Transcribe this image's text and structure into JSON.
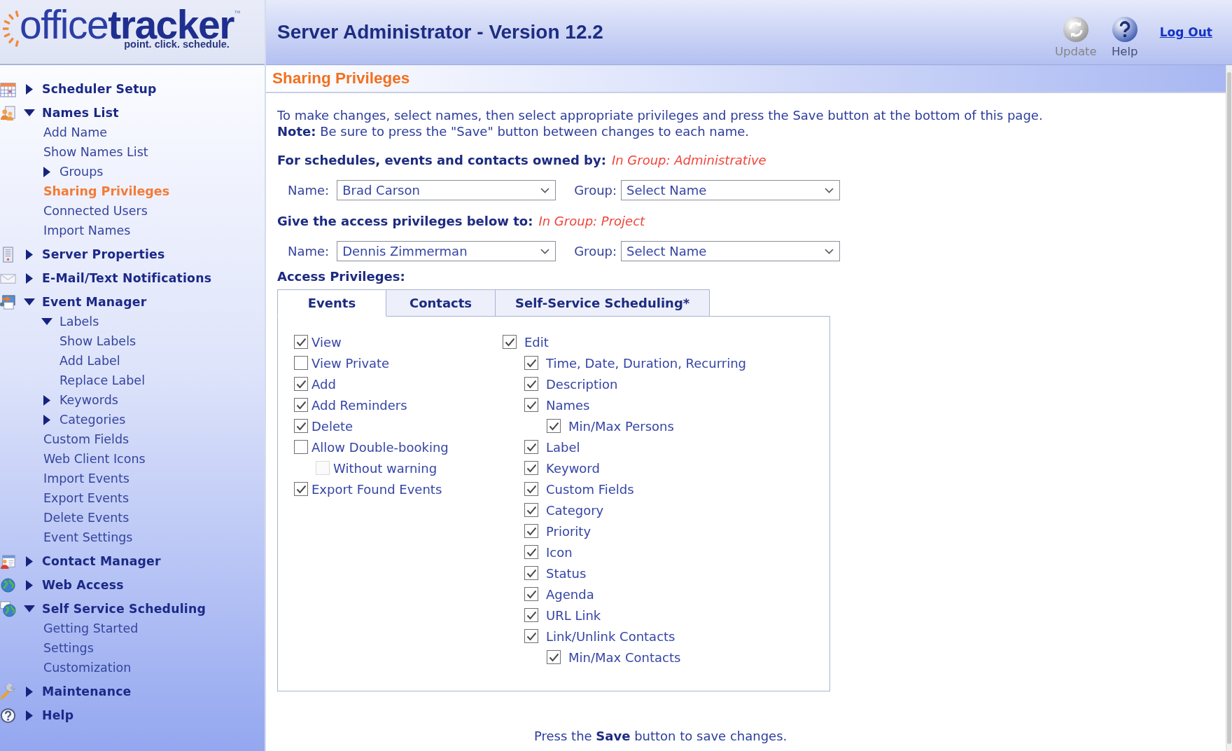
{
  "logo": {
    "brand_light": "office",
    "brand_bold": "tracker",
    "trademark": "™",
    "tagline": "point. click. schedule."
  },
  "sidebar": {
    "items": [
      {
        "label": "Scheduler Setup",
        "expanded": false,
        "selected": false
      },
      {
        "label": "Names List",
        "expanded": true,
        "selected": false,
        "children": [
          {
            "label": "Add Name",
            "selected": false
          },
          {
            "label": "Show Names List",
            "selected": false
          },
          {
            "label": "Groups",
            "expanded": false,
            "selected": false
          },
          {
            "label": "Sharing Privileges",
            "selected": true
          },
          {
            "label": "Connected Users",
            "selected": false
          },
          {
            "label": "Import Names",
            "selected": false
          }
        ]
      },
      {
        "label": "Server Properties",
        "expanded": false,
        "selected": false
      },
      {
        "label": "E-Mail/Text Notifications",
        "expanded": false,
        "selected": false
      },
      {
        "label": "Event Manager",
        "expanded": true,
        "selected": false,
        "children": [
          {
            "label": "Labels",
            "expanded": true,
            "selected": false,
            "children": [
              {
                "label": "Show Labels",
                "selected": false
              },
              {
                "label": "Add Label",
                "selected": false
              },
              {
                "label": "Replace Label",
                "selected": false
              }
            ]
          },
          {
            "label": "Keywords",
            "expanded": false,
            "selected": false
          },
          {
            "label": "Categories",
            "expanded": false,
            "selected": false
          },
          {
            "label": "Custom Fields",
            "selected": false
          },
          {
            "label": "Web Client Icons",
            "selected": false
          },
          {
            "label": "Import Events",
            "selected": false
          },
          {
            "label": "Export Events",
            "selected": false
          },
          {
            "label": "Delete Events",
            "selected": false
          },
          {
            "label": "Event Settings",
            "selected": false
          }
        ]
      },
      {
        "label": "Contact Manager",
        "expanded": false,
        "selected": false
      },
      {
        "label": "Web Access",
        "expanded": false,
        "selected": false
      },
      {
        "label": "Self Service Scheduling",
        "expanded": true,
        "selected": false,
        "children": [
          {
            "label": "Getting Started",
            "selected": false
          },
          {
            "label": "Settings",
            "selected": false
          },
          {
            "label": "Customization",
            "selected": false
          }
        ]
      },
      {
        "label": "Maintenance",
        "expanded": false,
        "selected": false
      },
      {
        "label": "Help",
        "expanded": false,
        "selected": false
      }
    ]
  },
  "header": {
    "title": "Server Administrator - Version 12.2",
    "buttons": [
      {
        "label": "Update",
        "disabled": true
      },
      {
        "label": "Help",
        "disabled": false
      }
    ],
    "logout": "Log Out"
  },
  "page": {
    "heading": "Sharing Privileges",
    "intro": "To make changes, select names, then select appropriate privileges and press the Save button at the bottom of this page.",
    "note": "**Note:** Be sure to press the \"Save\" button between changes to each name.",
    "owner": {
      "heading": "For schedules, events and contacts owned by:",
      "group_info": "In Group: Administrative",
      "fields": [
        {
          "label": "Name:",
          "value": "Brad Carson"
        },
        {
          "label": "Group:",
          "value": "Select Name"
        }
      ]
    },
    "recipient": {
      "heading": "Give the access privileges below to:",
      "group_info": "In Group: Project",
      "fields": [
        {
          "label": "Name:",
          "value": "Dennis Zimmerman"
        },
        {
          "label": "Group:",
          "value": "Select Name"
        }
      ]
    },
    "access_label": "Access Privileges:",
    "tabs": [
      {
        "label": "Events",
        "selected": true
      },
      {
        "label": "Contacts",
        "selected": false
      },
      {
        "label": "Self-Service Scheduling*",
        "selected": false
      }
    ],
    "columns": [
      {
        "items": [
          {
            "label": "View",
            "checked": true,
            "disabled": false
          },
          {
            "label": "View Private",
            "checked": false,
            "disabled": false
          },
          {
            "label": "Add",
            "checked": true,
            "disabled": false
          },
          {
            "label": "Add Reminders",
            "checked": true,
            "disabled": false
          },
          {
            "label": "Delete",
            "checked": true,
            "disabled": false
          },
          {
            "label": "Allow Double-booking",
            "checked": false,
            "disabled": false,
            "children": [
              {
                "label": "Without warning",
                "checked": false,
                "disabled": true
              }
            ]
          },
          {
            "label": "Export Found Events",
            "checked": true,
            "disabled": false
          }
        ]
      },
      {
        "items": [
          {
            "label": "Edit",
            "checked": true,
            "disabled": false,
            "children": [
              {
                "label": "Time, Date, Duration, Recurring",
                "checked": true,
                "disabled": false
              },
              {
                "label": "Description",
                "checked": true,
                "disabled": false
              },
              {
                "label": "Names",
                "checked": true,
                "disabled": false,
                "children": [
                  {
                    "label": "Min/Max Persons",
                    "checked": true,
                    "disabled": false
                  }
                ]
              },
              {
                "label": "Label",
                "checked": true,
                "disabled": false
              },
              {
                "label": "Keyword",
                "checked": true,
                "disabled": false
              },
              {
                "label": "Custom Fields",
                "checked": true,
                "disabled": false
              },
              {
                "label": "Category",
                "checked": true,
                "disabled": false
              },
              {
                "label": "Priority",
                "checked": true,
                "disabled": false
              },
              {
                "label": "Icon",
                "checked": true,
                "disabled": false
              },
              {
                "label": "Status",
                "checked": true,
                "disabled": false
              },
              {
                "label": "Agenda",
                "checked": true,
                "disabled": false
              },
              {
                "label": "URL Link",
                "checked": true,
                "disabled": false
              },
              {
                "label": "Link/Unlink Contacts",
                "checked": true,
                "disabled": false,
                "children": [
                  {
                    "label": "Min/Max Contacts",
                    "checked": true,
                    "disabled": false
                  }
                ]
              }
            ]
          }
        ]
      }
    ],
    "footer": "Press the **Save** button to save changes."
  }
}
